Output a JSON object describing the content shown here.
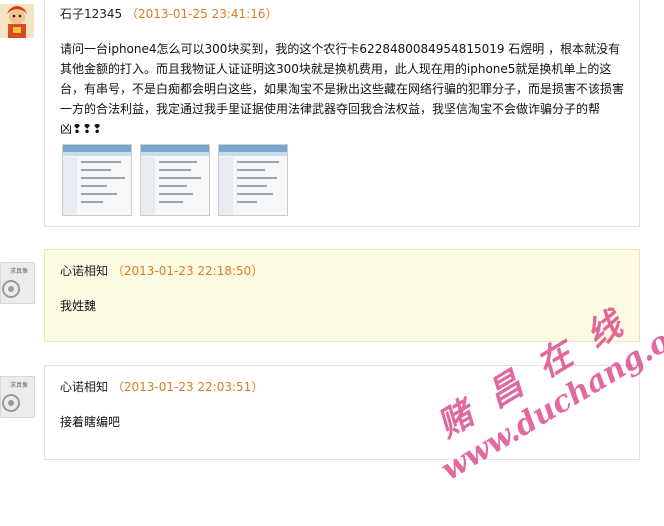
{
  "posts": [
    {
      "author": "石子12345",
      "timestamp": "2013-01-25 23:41:16",
      "text": "请问一台iphone4怎么可以300块买到，我的这个农行卡6228480084954815019 石煜明 ，根本就没有其他金额的打入。而且我物证人证证明这300块就是换机费用，此人现在用的iphone5就是换机单上的这台，有串号，不是白痴都会明白这些，如果淘宝不是揪出这些藏在网络行骗的犯罪分子，而是损害不该损害一方的合法利益，我定通过我手里证据使用法律武器夺回我合法权益，我坚信淘宝不会做诈骗分子的帮凶❢❢❢"
    },
    {
      "author": "心诺相知",
      "timestamp": "2013-01-23 22:18:50",
      "text": "我姓魏"
    },
    {
      "author": "心诺相知",
      "timestamp": "2013-01-23 22:03:51",
      "text": "接着瞎编吧"
    }
  ],
  "avatar_label": "求真像",
  "watermark": {
    "line1": "赌 昌 在 线",
    "line2": "www.duchang.org"
  }
}
